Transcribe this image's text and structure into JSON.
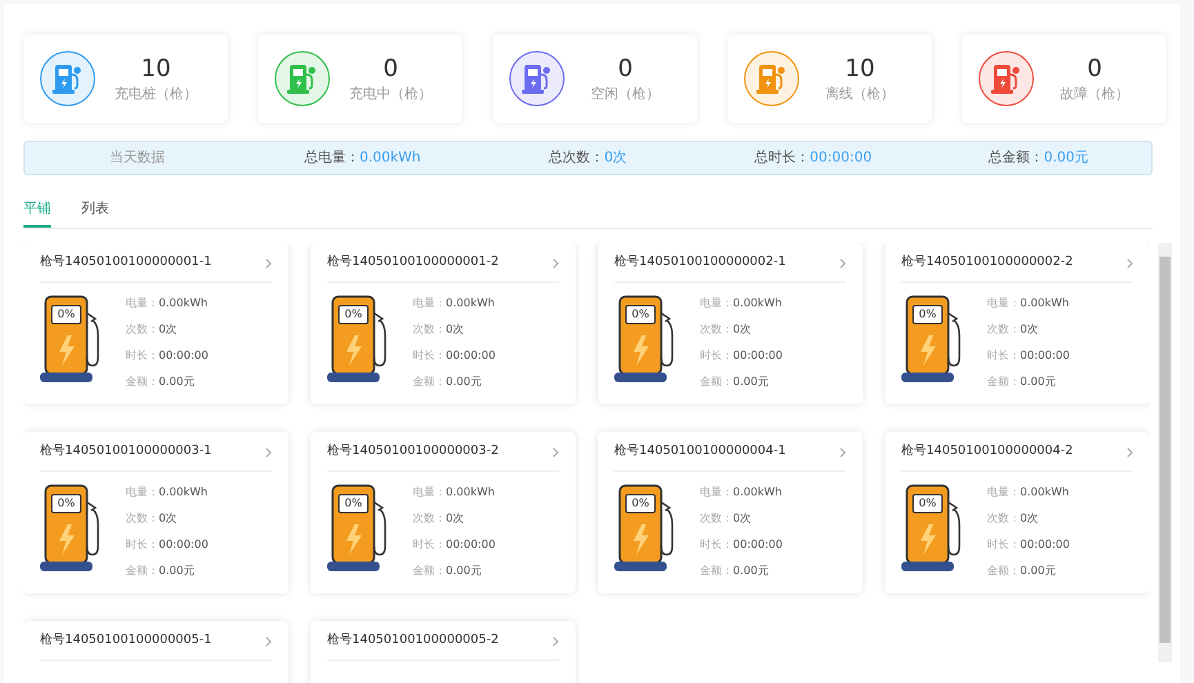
{
  "stats": [
    {
      "value": "10",
      "label": "充电桩（枪）",
      "color": "#2e9bf0"
    },
    {
      "value": "0",
      "label": "充电中（枪）",
      "color": "#2fbf4a"
    },
    {
      "value": "0",
      "label": "空闲（枪）",
      "color": "#6c6cf0"
    },
    {
      "value": "10",
      "label": "离线（枪）",
      "color": "#f0930f"
    },
    {
      "value": "0",
      "label": "故障（枪）",
      "color": "#ee4b3b"
    }
  ],
  "today": {
    "title": "当天数据",
    "items": [
      {
        "label": "总电量：",
        "value": "0.00kWh"
      },
      {
        "label": "总次数：",
        "value": "0次"
      },
      {
        "label": "总时长：",
        "value": "00:00:00"
      },
      {
        "label": "总金额：",
        "value": "0.00元"
      }
    ]
  },
  "tabs": [
    {
      "label": "平铺",
      "selected": true
    },
    {
      "label": "列表",
      "selected": false
    }
  ],
  "guns": [
    {
      "title": "枪号14050100100000001-1",
      "gauge": "0%",
      "fields": [
        {
          "label": "电量：",
          "value": "0.00kWh"
        },
        {
          "label": "次数：",
          "value": "0次"
        },
        {
          "label": "时长：",
          "value": "00:00:00"
        },
        {
          "label": "金额：",
          "value": "0.00元"
        }
      ]
    },
    {
      "title": "枪号14050100100000001-2",
      "gauge": "0%",
      "fields": [
        {
          "label": "电量：",
          "value": "0.00kWh"
        },
        {
          "label": "次数：",
          "value": "0次"
        },
        {
          "label": "时长：",
          "value": "00:00:00"
        },
        {
          "label": "金额：",
          "value": "0.00元"
        }
      ]
    },
    {
      "title": "枪号14050100100000002-1",
      "gauge": "0%",
      "fields": [
        {
          "label": "电量：",
          "value": "0.00kWh"
        },
        {
          "label": "次数：",
          "value": "0次"
        },
        {
          "label": "时长：",
          "value": "00:00:00"
        },
        {
          "label": "金额：",
          "value": "0.00元"
        }
      ]
    },
    {
      "title": "枪号14050100100000002-2",
      "gauge": "0%",
      "fields": [
        {
          "label": "电量：",
          "value": "0.00kWh"
        },
        {
          "label": "次数：",
          "value": "0次"
        },
        {
          "label": "时长：",
          "value": "00:00:00"
        },
        {
          "label": "金额：",
          "value": "0.00元"
        }
      ]
    },
    {
      "title": "枪号14050100100000003-1",
      "gauge": "0%",
      "fields": [
        {
          "label": "电量：",
          "value": "0.00kWh"
        },
        {
          "label": "次数：",
          "value": "0次"
        },
        {
          "label": "时长：",
          "value": "00:00:00"
        },
        {
          "label": "金额：",
          "value": "0.00元"
        }
      ]
    },
    {
      "title": "枪号14050100100000003-2",
      "gauge": "0%",
      "fields": [
        {
          "label": "电量：",
          "value": "0.00kWh"
        },
        {
          "label": "次数：",
          "value": "0次"
        },
        {
          "label": "时长：",
          "value": "00:00:00"
        },
        {
          "label": "金额：",
          "value": "0.00元"
        }
      ]
    },
    {
      "title": "枪号14050100100000004-1",
      "gauge": "0%",
      "fields": [
        {
          "label": "电量：",
          "value": "0.00kWh"
        },
        {
          "label": "次数：",
          "value": "0次"
        },
        {
          "label": "时长：",
          "value": "00:00:00"
        },
        {
          "label": "金额：",
          "value": "0.00元"
        }
      ]
    },
    {
      "title": "枪号14050100100000004-2",
      "gauge": "0%",
      "fields": [
        {
          "label": "电量：",
          "value": "0.00kWh"
        },
        {
          "label": "次数：",
          "value": "0次"
        },
        {
          "label": "时长：",
          "value": "00:00:00"
        },
        {
          "label": "金额：",
          "value": "0.00元"
        }
      ]
    },
    {
      "title": "枪号14050100100000005-1"
    },
    {
      "title": "枪号14050100100000005-2"
    }
  ]
}
